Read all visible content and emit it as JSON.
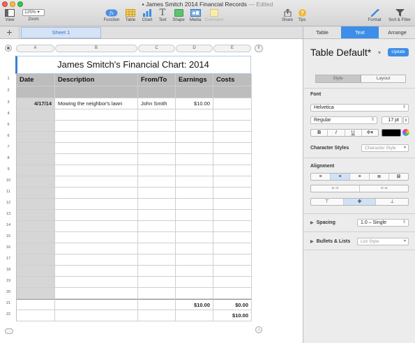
{
  "window": {
    "title": "James Smitch 2014 Financial Records",
    "edited": "— Edited"
  },
  "toolbar": {
    "view": "View",
    "zoom_value": "125%",
    "zoom": "Zoom",
    "function": "Function",
    "table": "Table",
    "chart": "Chart",
    "text": "Text",
    "shape": "Shape",
    "media": "Media",
    "comment": "Comment",
    "share": "Share",
    "tips": "Tips",
    "format": "Format",
    "sort_filter": "Sort & Filter"
  },
  "sheet_tab": "Sheet 1",
  "columns": [
    "A",
    "B",
    "C",
    "D",
    "E"
  ],
  "table": {
    "title": "James Smitch's Financial Chart: 2014",
    "headers": [
      "Date",
      "Description",
      "From/To",
      "Earnings",
      "Costs"
    ],
    "rows": [
      [
        "4/17/14",
        "Mowing the neighbor's lawn",
        "John Smith",
        "$10.00",
        ""
      ]
    ],
    "totals": [
      "",
      "",
      "",
      "$10.00",
      "$0.00"
    ],
    "balance": [
      "",
      "",
      "",
      "",
      "$10.00"
    ],
    "row_numbers": [
      "1",
      "2",
      "3",
      "4",
      "5",
      "6",
      "7",
      "8",
      "9",
      "10",
      "11",
      "12",
      "13",
      "14",
      "15",
      "16",
      "17",
      "18",
      "19",
      "20",
      "21",
      "22"
    ]
  },
  "panel": {
    "tabs": [
      "Table",
      "Text",
      "Arrange"
    ],
    "active_tab": "Text",
    "style_name": "Table Default*",
    "update_button": "Update",
    "style_tab": "Style",
    "layout_tab": "Layout",
    "font_label": "Font",
    "font_family": "Helvetica",
    "font_style": "Regular",
    "font_size": "17 pt",
    "bold": "B",
    "italic": "I",
    "underline": "U",
    "text_options": "✲▾",
    "character_styles_label": "Character Styles",
    "character_style_value": "Character Style",
    "alignment_label": "Alignment",
    "spacing_label": "Spacing",
    "spacing_value": "1.0 – Single",
    "bullets_label": "Bullets & Lists",
    "bullets_value": "List Style"
  },
  "colors": {
    "accent": "#3d8ee8",
    "header_fill": "#bdbdbd",
    "date_column_fill": "#d6d6d6"
  }
}
